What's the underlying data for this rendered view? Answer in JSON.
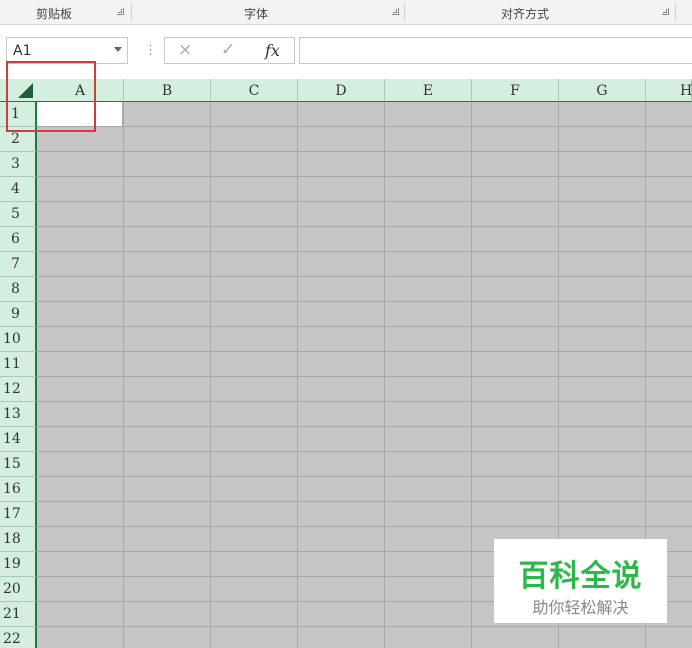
{
  "ribbon": {
    "groups": [
      {
        "label": "剪贴板"
      },
      {
        "label": "字体"
      },
      {
        "label": "对齐方式"
      }
    ]
  },
  "formula_bar": {
    "name_box": "A1",
    "cancel_icon": "×",
    "enter_icon": "✓",
    "fx_label": "fx",
    "formula_value": ""
  },
  "sheet": {
    "columns": [
      "A",
      "B",
      "C",
      "D",
      "E",
      "F",
      "G",
      "H"
    ],
    "rows": [
      "1",
      "2",
      "3",
      "4",
      "5",
      "6",
      "7",
      "8",
      "9",
      "10",
      "11",
      "12",
      "13",
      "14",
      "15",
      "16",
      "17",
      "18",
      "19",
      "20",
      "21",
      "22"
    ],
    "selected_cell": "A1"
  },
  "colors": {
    "header_bg": "#d4efdf",
    "header_border": "#1a7a45",
    "cell_fill": "#c5c5c5",
    "highlight": "#d23b3b",
    "watermark_green": "#2fb84a"
  },
  "watermark": {
    "title": "百科全说",
    "subtitle": "助你轻松解决"
  }
}
